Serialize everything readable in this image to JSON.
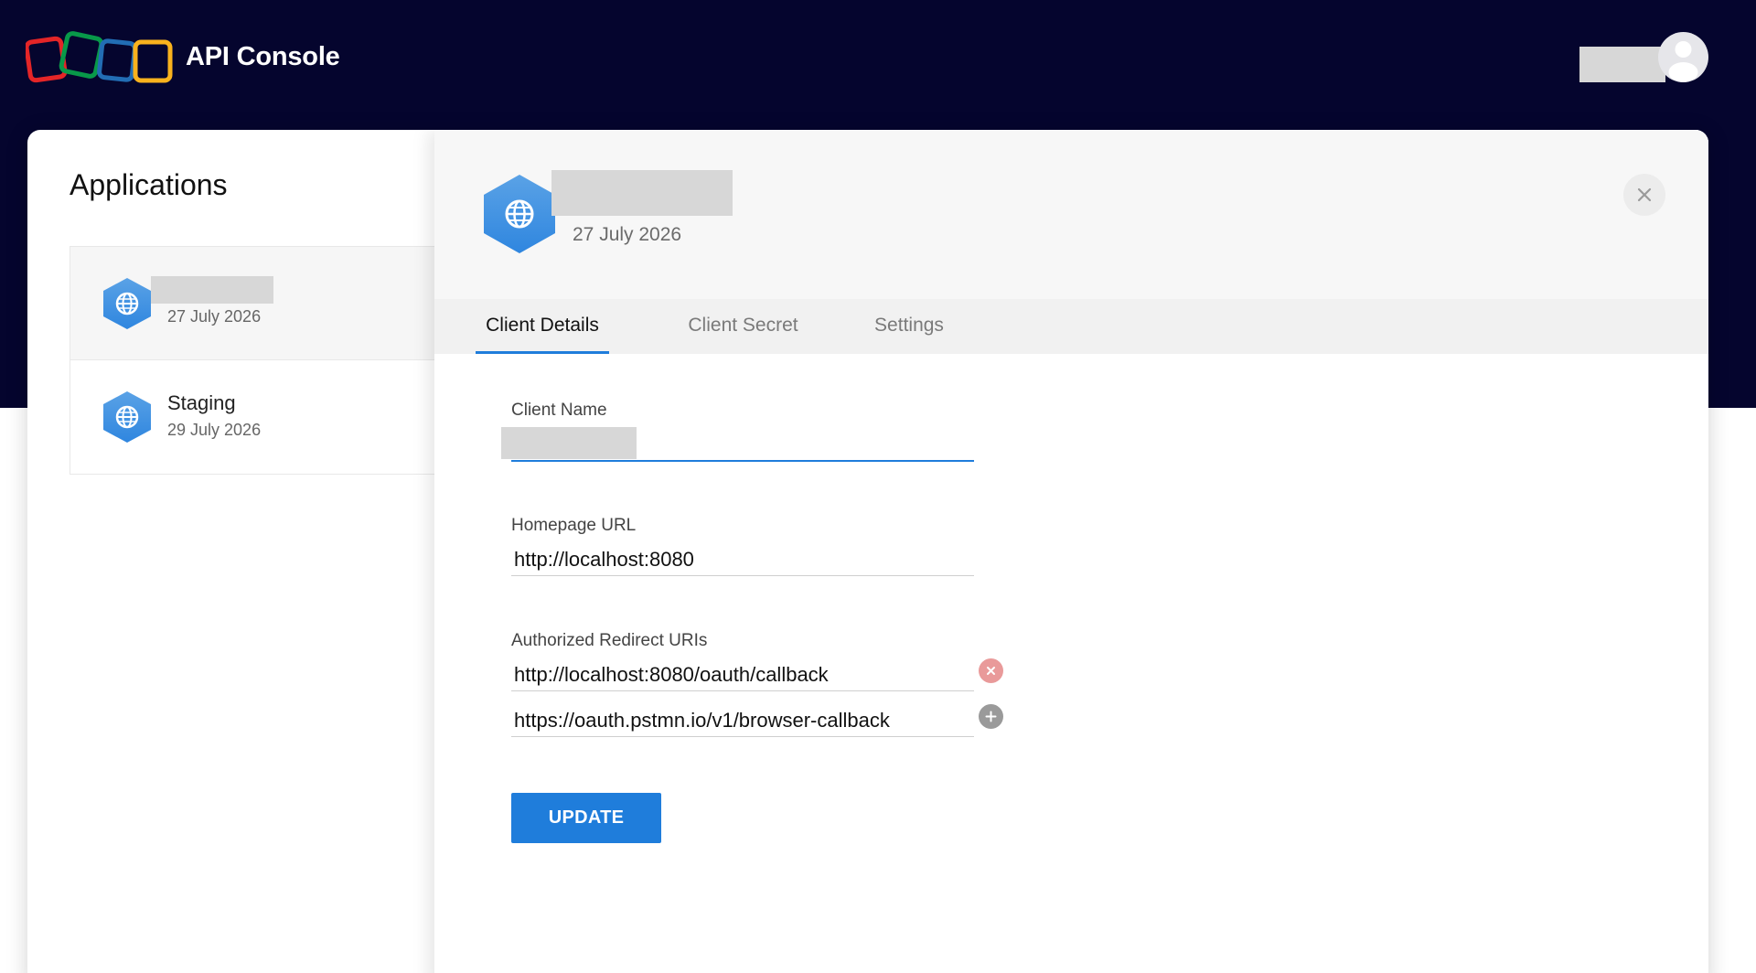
{
  "header": {
    "brand": "API Console",
    "logo_colors": [
      "#e42527",
      "#089949",
      "#226db4",
      "#f9b21d"
    ]
  },
  "sidebar": {
    "title": "Applications",
    "apps": [
      {
        "name": "",
        "date": "27 July 2026",
        "active": true
      },
      {
        "name": "Staging",
        "date": "29 July 2026",
        "active": false
      }
    ]
  },
  "detail": {
    "date": "27 July 2026",
    "tabs": [
      {
        "label": "Client Details",
        "active": true
      },
      {
        "label": "Client Secret",
        "active": false
      },
      {
        "label": "Settings",
        "active": false
      }
    ],
    "fields": {
      "client_name_label": "Client Name",
      "client_name_value": "",
      "homepage_label": "Homepage URL",
      "homepage_value": "http://localhost:8080",
      "redirect_label": "Authorized Redirect URIs",
      "redirect_uris": [
        "http://localhost:8080/oauth/callback",
        "https://oauth.pstmn.io/v1/browser-callback"
      ]
    },
    "update_label": "UPDATE"
  },
  "colors": {
    "accent": "#1f7ddb",
    "header_bg": "#05052e",
    "remove": "#e26b6b",
    "add": "#9a9a9a"
  },
  "icons": [
    "globe-icon",
    "close-icon",
    "remove-icon",
    "add-icon",
    "user-icon"
  ]
}
